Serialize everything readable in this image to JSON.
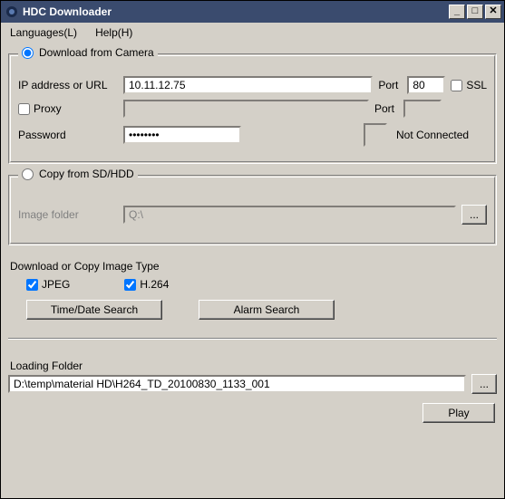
{
  "window": {
    "title": "HDC Downloader"
  },
  "menu": {
    "languages": "Languages(L)",
    "help": "Help(H)"
  },
  "camera_group": {
    "legend": "Download from Camera",
    "ip_label": "IP address or URL",
    "ip_value": "10.11.12.75",
    "port_label": "Port",
    "port_value": "80",
    "ssl_label": "SSL",
    "proxy_label": "Proxy",
    "proxy_value": "",
    "proxy_port_label": "Port",
    "proxy_port_value": "",
    "password_label": "Password",
    "password_value": "********",
    "status_text": "Not Connected"
  },
  "sd_group": {
    "legend": "Copy from SD/HDD",
    "folder_label": "Image folder",
    "folder_value": "Q:\\",
    "browse_label": "..."
  },
  "type_section": {
    "heading": "Download or Copy Image Type",
    "jpeg_label": "JPEG",
    "h264_label": "H.264",
    "time_search_label": "Time/Date Search",
    "alarm_search_label": "Alarm Search"
  },
  "loading": {
    "heading": "Loading Folder",
    "path": "D:\\temp\\material HD\\H264_TD_20100830_1133_001",
    "browse_label": "...",
    "play_label": "Play"
  }
}
